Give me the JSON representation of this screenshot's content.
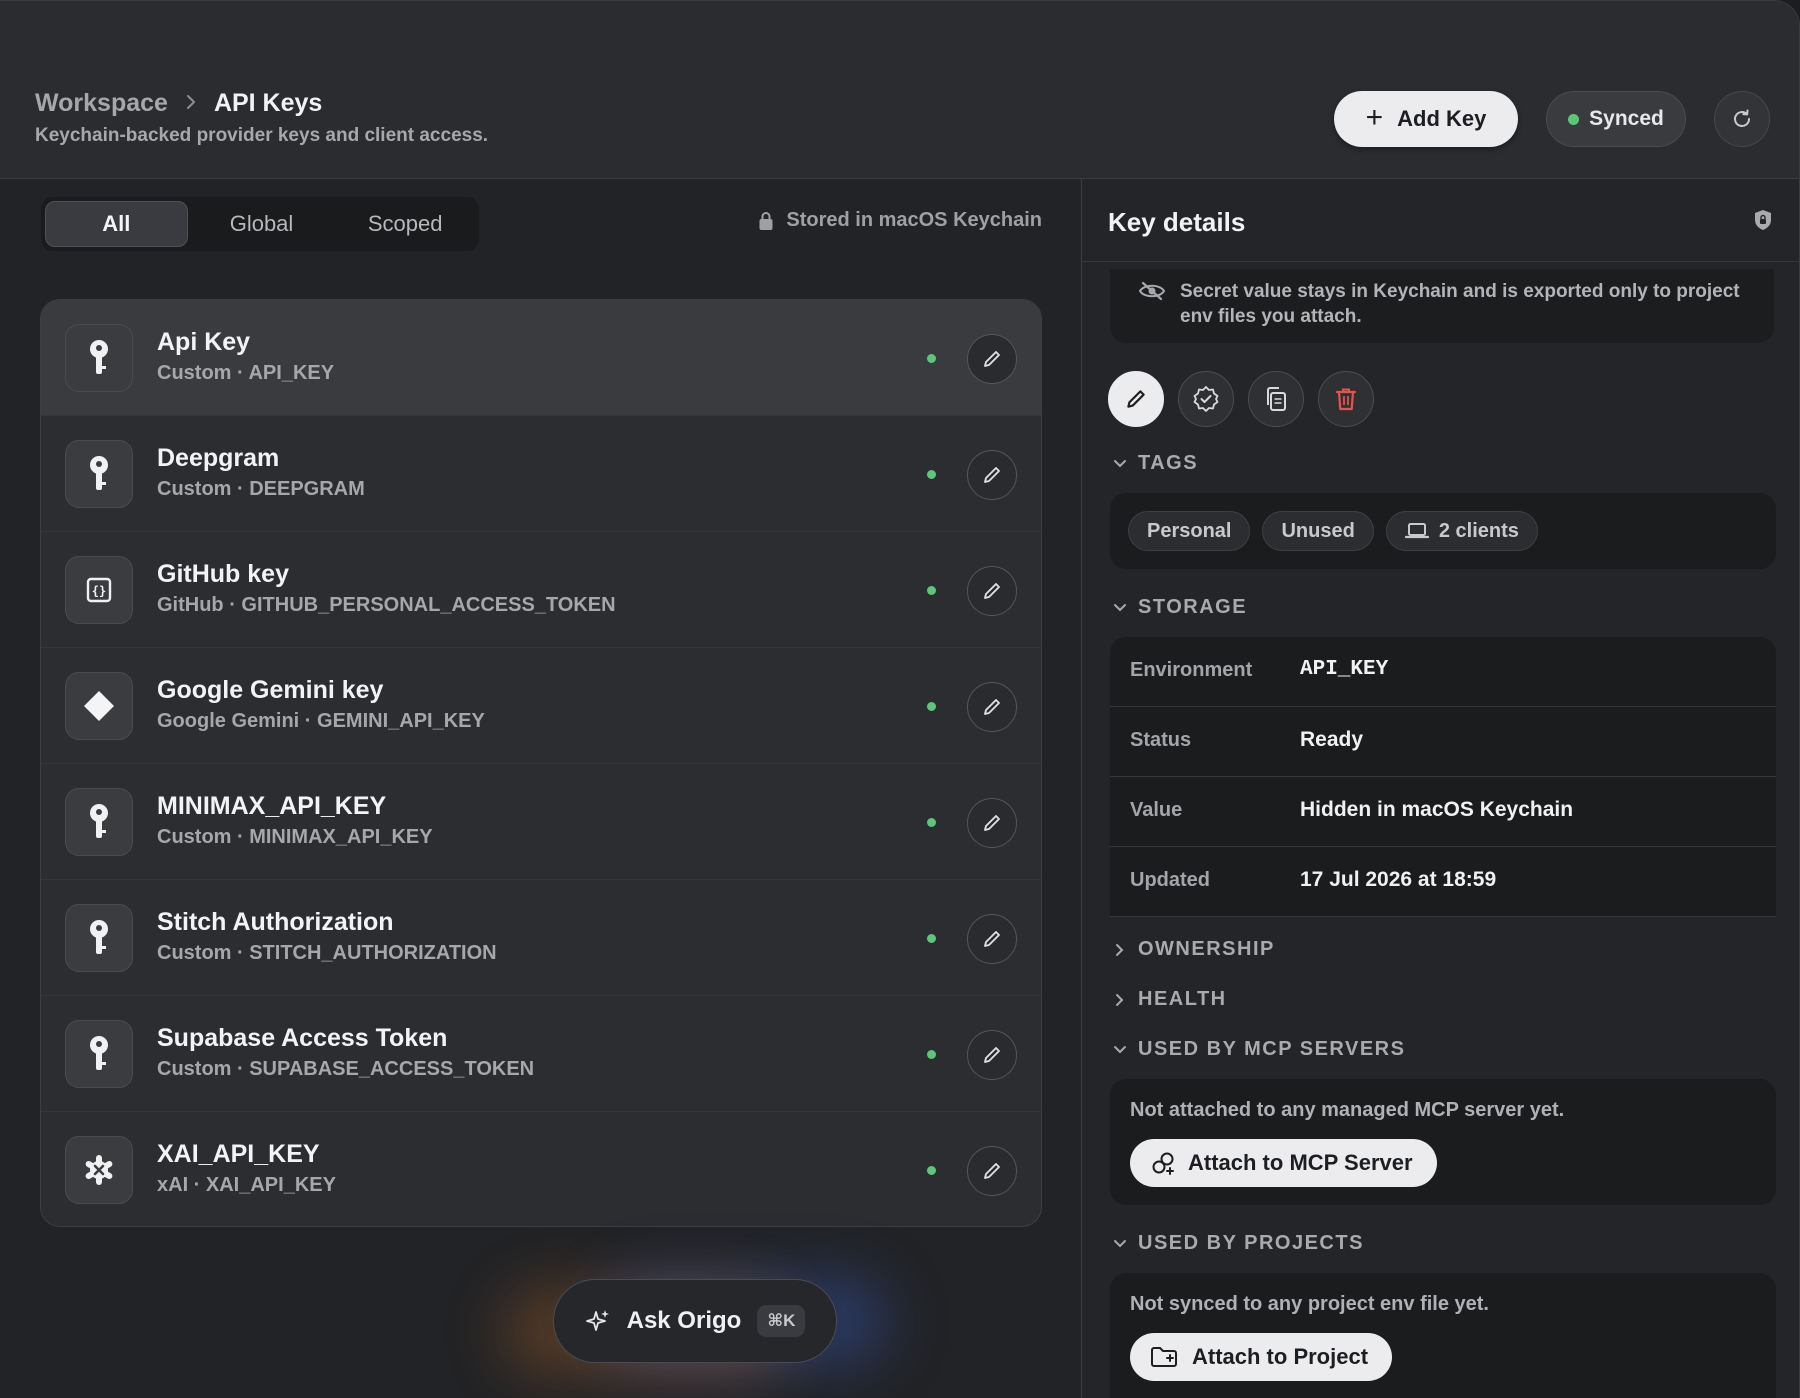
{
  "header": {
    "breadcrumb_root": "Workspace",
    "breadcrumb_leaf": "API Keys",
    "subtitle": "Keychain-backed provider keys and client access.",
    "add_key_label": "Add Key",
    "sync_status": "Synced"
  },
  "filter": {
    "tabs": [
      "All",
      "Global",
      "Scoped"
    ],
    "active": "All",
    "storage_note": "Stored in macOS Keychain"
  },
  "keys": [
    {
      "title": "Api Key",
      "subtitle": "Custom · API_KEY",
      "icon": "key-icon"
    },
    {
      "title": "Deepgram",
      "subtitle": "Custom · DEEPGRAM",
      "icon": "key-icon"
    },
    {
      "title": "GitHub key",
      "subtitle": "GitHub · GITHUB_PERSONAL_ACCESS_TOKEN",
      "icon": "github-icon"
    },
    {
      "title": "Google Gemini key",
      "subtitle": "Google Gemini · GEMINI_API_KEY",
      "icon": "diamond-icon"
    },
    {
      "title": "MINIMAX_API_KEY",
      "subtitle": "Custom · MINIMAX_API_KEY",
      "icon": "key-icon"
    },
    {
      "title": "Stitch Authorization",
      "subtitle": "Custom · STITCH_AUTHORIZATION",
      "icon": "key-icon"
    },
    {
      "title": "Supabase Access Token",
      "subtitle": "Custom · SUPABASE_ACCESS_TOKEN",
      "icon": "key-icon"
    },
    {
      "title": "XAI_API_KEY",
      "subtitle": "xAI · XAI_API_KEY",
      "icon": "xai-icon"
    }
  ],
  "ask": {
    "label": "Ask Origo",
    "shortcut": "⌘K"
  },
  "details": {
    "title": "Key details",
    "notice": "Secret value stays in Keychain and is exported only to project env files you attach.",
    "sections": {
      "tags": "TAGS",
      "storage": "STORAGE",
      "ownership": "OWNERSHIP",
      "health": "HEALTH",
      "mcp": "USED BY MCP SERVERS",
      "projects": "USED BY PROJECTS"
    },
    "tags": [
      "Personal",
      "Unused",
      "2 clients"
    ],
    "storage": [
      {
        "label": "Environment",
        "value": "API_KEY"
      },
      {
        "label": "Status",
        "value": "Ready"
      },
      {
        "label": "Value",
        "value": "Hidden in macOS Keychain"
      },
      {
        "label": "Updated",
        "value": "17 Jul 2026 at 18:59"
      }
    ],
    "mcp_empty": "Not attached to any managed MCP server yet.",
    "mcp_button": "Attach to MCP Server",
    "projects_empty": "Not synced to any project env file yet.",
    "projects_button": "Attach to Project"
  },
  "colors": {
    "accent_green": "#5cc777",
    "danger": "#e5534b"
  }
}
